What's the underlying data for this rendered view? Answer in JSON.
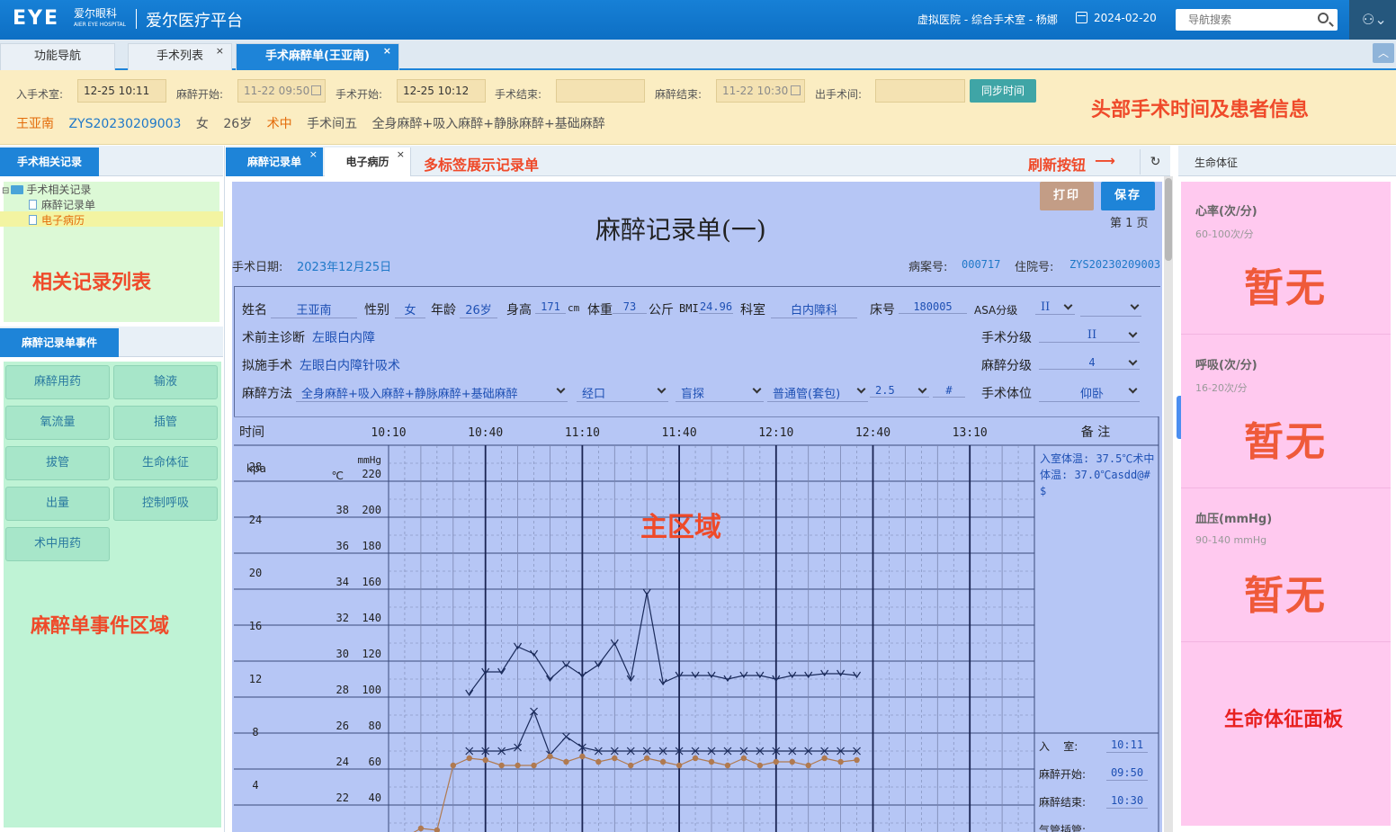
{
  "topbar": {
    "logo_mark": "EYE",
    "logo_cn": "爱尔眼科",
    "logo_en": "AIER EYE HOSPITAL",
    "platform_title": "爱尔医疗平台",
    "hospital_info": "虚拟医院 - 综合手术室 - 杨娜",
    "date": "2024-02-20",
    "search_placeholder": "导航搜索"
  },
  "tabs": [
    {
      "label": "功能导航"
    },
    {
      "label": "手术列表"
    },
    {
      "label": "手术麻醉单(王亚南)"
    }
  ],
  "times": {
    "in_room_label": "入手术室:",
    "in_room": "12-25 10:11",
    "anes_start_label": "麻醉开始:",
    "anes_start": "11-22 09:50",
    "op_start_label": "手术开始:",
    "op_start": "12-25 10:12",
    "op_end_label": "手术结束:",
    "op_end": "",
    "anes_end_label": "麻醉结束:",
    "anes_end": "11-22 10:30",
    "out_label": "出手术间:",
    "out": "",
    "sync_label": "同步时间"
  },
  "patient": {
    "name": "王亚南",
    "id": "ZYS20230209003",
    "sex": "女",
    "age": "26岁",
    "status": "术中",
    "room": "手术间五",
    "method": "全身麻醉+吸入麻醉+静脉麻醉+基础麻醉"
  },
  "annotations": {
    "header": "头部手术时间及患者信息",
    "tabs": "多标签展示记录单",
    "refresh": "刷新按钮",
    "list": "相关记录列表",
    "events": "麻醉单事件区域",
    "main": "主区域",
    "vitals": "生命体征面板"
  },
  "left": {
    "records_tab": "手术相关记录",
    "tree_root": "手术相关记录",
    "tree_items": [
      "麻醉记录单",
      "电子病历"
    ],
    "events_tab": "麻醉记录单事件",
    "events": [
      "麻醉用药",
      "输液",
      "氧流量",
      "插管",
      "拔管",
      "生命体征",
      "出量",
      "控制呼吸",
      "术中用药"
    ]
  },
  "center": {
    "tabs": [
      "麻醉记录单",
      "电子病历"
    ],
    "print": "打印",
    "save": "保存",
    "title": "麻醉记录单(一)",
    "page": "第 1 页",
    "op_date_label": "手术日期:",
    "op_date": "2023年12月25日",
    "case_no_label": "病案号:",
    "case_no": "000717",
    "inpatient_label": "住院号:",
    "inpatient_no": "ZYS20230209003"
  },
  "form": {
    "name_label": "姓名",
    "name": "王亚南",
    "sex_label": "性别",
    "sex": "女",
    "age_label": "年龄",
    "age": "26岁",
    "height_label": "身高",
    "height": "171",
    "height_unit": "cm",
    "weight_label": "体重",
    "weight": "73",
    "weight_unit": "公斤",
    "bmi_label": "BMI",
    "bmi": "24.96",
    "dept_label": "科室",
    "dept": "白内障科",
    "bed_label": "床号",
    "bed": "180005",
    "asa_label": "ASA分级",
    "asa": "II",
    "asa2": "",
    "diag_label": "术前主诊断",
    "diag": "左眼白内障",
    "surg_grade_label": "手术分级",
    "surg_grade": "II",
    "plan_label": "拟施手术",
    "plan": "左眼白内障针吸术",
    "anes_grade_label": "麻醉分级",
    "anes_grade": "4",
    "method_label": "麻醉方法",
    "method": "全身麻醉+吸入麻醉+静脉麻醉+基础麻醉",
    "route": "经口",
    "intub": "盲探",
    "tube": "普通管(套包)",
    "size": "2.5",
    "hash": "#",
    "position_label": "手术体位",
    "position": "仰卧"
  },
  "chart_data": {
    "type": "line",
    "time_label": "时间",
    "remark_label": "备 注",
    "time_ticks": [
      "10:10",
      "10:40",
      "11:10",
      "11:40",
      "12:10",
      "12:40",
      "13:10"
    ],
    "kpa_label": "kpa",
    "kpa_ticks": [
      "28",
      "24",
      "20",
      "16",
      "12",
      "8",
      "4"
    ],
    "temp_label": "℃",
    "temp_ticks": [
      "38",
      "36",
      "34",
      "32",
      "30",
      "28",
      "26",
      "24",
      "22"
    ],
    "mmhg_label": "mmHg",
    "mmhg_ticks": [
      "220",
      "200",
      "180",
      "160",
      "140",
      "120",
      "100",
      "80",
      "60",
      "40"
    ],
    "x_range_minutes": [
      0,
      200
    ],
    "y_range_mmhg": [
      20,
      240
    ],
    "series": [
      {
        "color": "#1a2a5a",
        "marker": "v",
        "x": [
          25,
          30,
          35,
          40,
          45,
          50,
          55,
          60,
          65,
          70,
          75,
          80,
          85,
          90,
          95,
          100,
          105,
          110,
          115,
          120,
          125,
          130,
          135,
          140,
          145
        ],
        "values": [
          102,
          114,
          114,
          128,
          124,
          110,
          118,
          112,
          118,
          130,
          110,
          158,
          108,
          112,
          112,
          112,
          110,
          112,
          112,
          110,
          112,
          112,
          113,
          113,
          112
        ]
      },
      {
        "color": "#1a2a5a",
        "marker": "x",
        "x": [
          25,
          30,
          35,
          40,
          45,
          50,
          55,
          60,
          65,
          70,
          75,
          80,
          85,
          90,
          95,
          100,
          105,
          110,
          115,
          120,
          125,
          130,
          135,
          140,
          145
        ],
        "values": [
          70,
          70,
          70,
          72,
          92,
          68,
          78,
          72,
          70,
          70,
          70,
          70,
          70,
          70,
          70,
          70,
          70,
          70,
          70,
          70,
          70,
          70,
          70,
          70,
          70
        ]
      },
      {
        "color": "#b07a50",
        "marker": "dot",
        "x": [
          0,
          5,
          10,
          15,
          20,
          25,
          30,
          35,
          40,
          45,
          50,
          55,
          60,
          65,
          70,
          75,
          80,
          85,
          90,
          95,
          100,
          105,
          110,
          115,
          120,
          125,
          130,
          135,
          140,
          145
        ],
        "values": [
          20,
          22,
          27,
          26,
          62,
          66,
          65,
          62,
          62,
          62,
          67,
          64,
          67,
          64,
          66,
          62,
          66,
          64,
          62,
          66,
          64,
          62,
          66,
          62,
          64,
          64,
          62,
          66,
          64,
          65
        ]
      }
    ],
    "remark_text": "入室体温: 37.5℃术中体温: 37.0℃asdd@#$",
    "events": [
      {
        "label": "入    室:",
        "time": "10:11"
      },
      {
        "label": "麻醉开始:",
        "time": "09:50"
      },
      {
        "label": "麻醉结束:",
        "time": "10:30"
      },
      {
        "label": "气管插管:",
        "time": ""
      }
    ]
  },
  "vitals": {
    "title": "生命体征",
    "items": [
      {
        "name": "心率(次/分)",
        "range": "60-100次/分",
        "value": "暂无"
      },
      {
        "name": "呼吸(次/分)",
        "range": "16-20次/分",
        "value": "暂无"
      },
      {
        "name": "血压(mmHg)",
        "range": "90-140 mmHg",
        "value": "暂无"
      }
    ]
  }
}
